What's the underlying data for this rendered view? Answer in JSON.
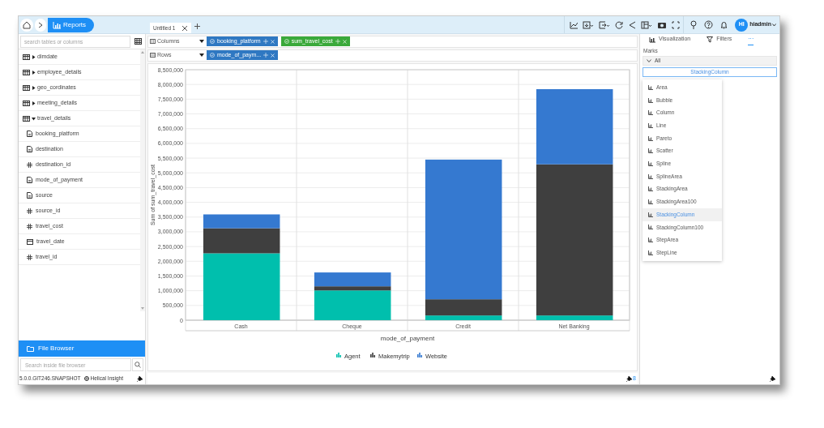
{
  "breadcrumb": {
    "current": "Reports"
  },
  "tabs": [
    {
      "label": "Untitled 1",
      "selected": true
    }
  ],
  "user": {
    "initials": "HI",
    "name": "hiadmin"
  },
  "data_panel": {
    "search": {
      "placeholder": "search tables or columns"
    },
    "tree": [
      {
        "label": "dimdate",
        "kind": "table",
        "expanded": false
      },
      {
        "label": "employee_details",
        "kind": "table",
        "expanded": false
      },
      {
        "label": "geo_cordinates",
        "kind": "table",
        "expanded": false
      },
      {
        "label": "meeting_details",
        "kind": "table",
        "expanded": false
      },
      {
        "label": "travel_details",
        "kind": "table",
        "expanded": true,
        "children": [
          {
            "label": "booking_platform",
            "kind": "text"
          },
          {
            "label": "destination",
            "kind": "text"
          },
          {
            "label": "destination_id",
            "kind": "number"
          },
          {
            "label": "mode_of_payment",
            "kind": "text"
          },
          {
            "label": "source",
            "kind": "text"
          },
          {
            "label": "source_id",
            "kind": "number"
          },
          {
            "label": "travel_cost",
            "kind": "number"
          },
          {
            "label": "travel_date",
            "kind": "date"
          },
          {
            "label": "travel_id",
            "kind": "number"
          }
        ]
      }
    ]
  },
  "file_browser": {
    "title": "File Browser",
    "search": {
      "placeholder": "Search inside file browser"
    }
  },
  "footer": {
    "version": "5.0.0.GIT246.SNAPSHOT",
    "brand": "Helical Insight"
  },
  "shelves": [
    {
      "label": "Columns",
      "pills": [
        {
          "label": "booking_platform",
          "color": "#2f78c2"
        },
        {
          "label": "sum_travel_cost",
          "color": "#3aa93a"
        }
      ]
    },
    {
      "label": "Rows",
      "pills": [
        {
          "label": "mode_of_paym...",
          "color": "#2f78c2"
        }
      ]
    }
  ],
  "chart_data": {
    "type": "bar",
    "stacked": true,
    "grid": true,
    "legend": true,
    "xlabel": "mode_of_payment",
    "ylabel": "Sum of sum_travel_cost",
    "categories": [
      "Cash",
      "Cheque",
      "Credit",
      "Net Banking"
    ],
    "series": [
      {
        "name": "Agent",
        "color": "#00bfad",
        "values": [
          2270000,
          1010000,
          160000,
          160000
        ]
      },
      {
        "name": "Makemytrip",
        "color": "#3f3f3f",
        "values": [
          850000,
          140000,
          550000,
          5130000
        ]
      },
      {
        "name": "Website",
        "color": "#3579d0",
        "values": [
          470000,
          470000,
          4740000,
          2550000
        ]
      }
    ],
    "ylim": [
      0,
      8500000
    ],
    "yticks": [
      {
        "value": 0,
        "label": "0"
      },
      {
        "value": 500000,
        "label": "500,000"
      },
      {
        "value": 1000000,
        "label": "1,000,000"
      },
      {
        "value": 1500000,
        "label": "1,500,000"
      },
      {
        "value": 2000000,
        "label": "2,000,000"
      },
      {
        "value": 2500000,
        "label": "2,500,000"
      },
      {
        "value": 3000000,
        "label": "3,000,000"
      },
      {
        "value": 3500000,
        "label": "3,500,000"
      },
      {
        "value": 4000000,
        "label": "4,000,000"
      },
      {
        "value": 4500000,
        "label": "4,500,000"
      },
      {
        "value": 5000000,
        "label": "5,000,000"
      },
      {
        "value": 5500000,
        "label": "5,500,000"
      },
      {
        "value": 6000000,
        "label": "6,000,000"
      },
      {
        "value": 6500000,
        "label": "6,500,000"
      },
      {
        "value": 7000000,
        "label": "7,000,000"
      },
      {
        "value": 7500000,
        "label": "7,500,000"
      },
      {
        "value": 8000000,
        "label": "8,000,000"
      },
      {
        "value": 8500000,
        "label": "8,500,000"
      }
    ]
  },
  "canvas_footer": {
    "count": "8"
  },
  "side_tabs": [
    {
      "label": "Visualization",
      "kind": "chart",
      "selected": false
    },
    {
      "label": "Filters",
      "kind": "filter",
      "selected": false
    },
    {
      "label": "···",
      "kind": "more",
      "selected": true
    }
  ],
  "marks": {
    "title": "Marks",
    "group": "All",
    "value": "StackingColumn",
    "options": [
      {
        "label": "Area",
        "selected": false
      },
      {
        "label": "Bubble",
        "selected": false
      },
      {
        "label": "Column",
        "selected": false
      },
      {
        "label": "Line",
        "selected": false
      },
      {
        "label": "Pareto",
        "selected": false
      },
      {
        "label": "Scatter",
        "selected": false
      },
      {
        "label": "Spline",
        "selected": false
      },
      {
        "label": "SplineArea",
        "selected": false
      },
      {
        "label": "StackingArea",
        "selected": false
      },
      {
        "label": "StackingArea100",
        "selected": false
      },
      {
        "label": "StackingColumn",
        "selected": true
      },
      {
        "label": "StackingColumn100",
        "selected": false
      },
      {
        "label": "StepArea",
        "selected": false
      },
      {
        "label": "StepLine",
        "selected": false
      }
    ]
  }
}
